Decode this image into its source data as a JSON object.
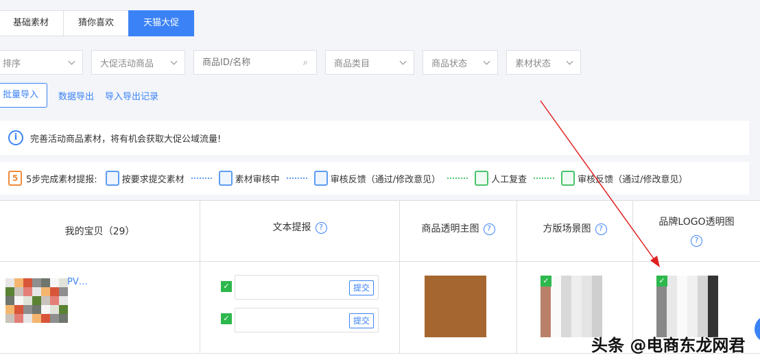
{
  "tabs": [
    {
      "label": "基础素材"
    },
    {
      "label": "猜你喜欢"
    },
    {
      "label": "天猫大促"
    }
  ],
  "filters": {
    "sort": "排序",
    "promo": "大促活动商品",
    "search_placeholder": "商品ID/名称",
    "category": "商品类目",
    "product_status": "商品状态",
    "material_status": "素材状态"
  },
  "actions": {
    "batch_import": "批量导入",
    "data_export": "数据导出",
    "records": "导入导出记录"
  },
  "notice": "完善活动商品素材，将有机会获取大促公域流量!",
  "steps": {
    "title": "5步完成素材提报:",
    "items": [
      "按要求提交素材",
      "素材审核中",
      "审核反馈（通过/修改意见）",
      "人工复查",
      "审核反馈（通过/修改意见）"
    ]
  },
  "table": {
    "headers": [
      "我的宝贝（29）",
      "文本提报",
      "商品透明主图",
      "方版场景图",
      "品牌LOGO透明图"
    ],
    "row": {
      "title_prefix": "PV…",
      "submit": "提交"
    }
  },
  "watermark": "头条 @电商东龙网君",
  "colors": {
    "accent": "#3b82f6",
    "success": "#2db84d",
    "arrow": "#e02020"
  }
}
